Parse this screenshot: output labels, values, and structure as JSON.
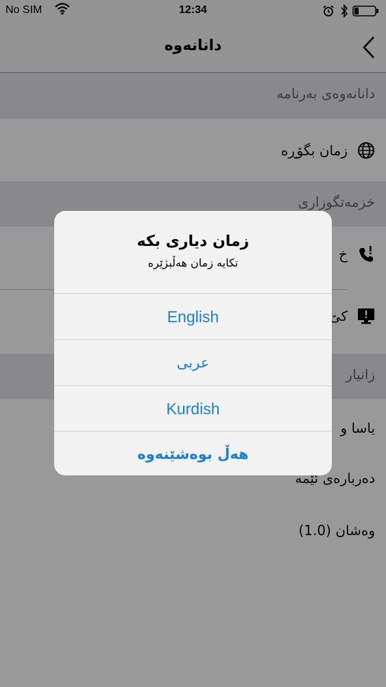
{
  "status_bar": {
    "carrier": "No SIM",
    "time": "12:34"
  },
  "nav": {
    "title": "دانانەوە"
  },
  "sections": {
    "app_settings": {
      "header": "دانانەوەی بەرنامە",
      "change_language": "زمان بگۆڕە"
    },
    "services": {
      "header": "خزمەتگوزاری",
      "row1": "خ",
      "row2": "کێ"
    },
    "info": {
      "header": "زانیار",
      "row1": "یاسا و",
      "row2": "دەربارەی ئێمە",
      "version": "وەشان  (1.0)"
    }
  },
  "alert": {
    "title": "زمان دیاری بکە",
    "message": "تکایە زمان هەڵبژێرە",
    "options": [
      "English",
      "عربى",
      "Kurdish"
    ],
    "cancel": "هەڵ بوەشێنەوە"
  },
  "colors": {
    "accent": "#1a7fd6",
    "overlay": "rgba(0,0,0,0.40)",
    "section_bg": "#e4e4e8"
  }
}
